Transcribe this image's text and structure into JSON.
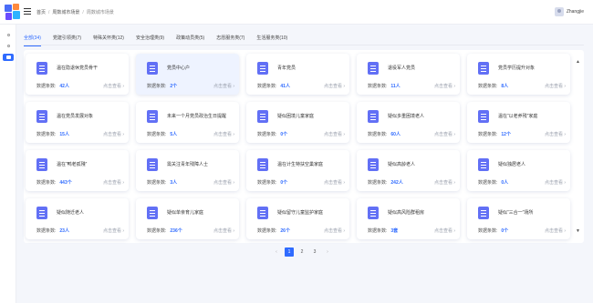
{
  "header": {
    "breadcrumb": [
      "首页",
      "周数城市场景",
      "周数城市场景"
    ],
    "user": "Zhangjie"
  },
  "tabs": [
    {
      "label": "全部(34)",
      "active": true
    },
    {
      "label": "党建引领类(7)"
    },
    {
      "label": "特殊关怀类(12)"
    },
    {
      "label": "安全治理类(9)"
    },
    {
      "label": "政策动员类(5)"
    },
    {
      "label": "志愿服务类(7)"
    },
    {
      "label": "生活服务类(10)"
    }
  ],
  "cards": [
    {
      "title": "温在隐退休党员骨干",
      "label": "数据条数:",
      "value": "42人",
      "link": "点击查看 ›"
    },
    {
      "title": "党员中心户",
      "label": "数据条数:",
      "value": "2个",
      "link": "点击查看 ›",
      "highlight": true
    },
    {
      "title": "青年党员",
      "label": "数据条数:",
      "value": "41人",
      "link": "点击查看 ›"
    },
    {
      "title": "退役军人党员",
      "label": "数据条数:",
      "value": "11人",
      "link": "点击查看 ›"
    },
    {
      "title": "党员学历提升对象",
      "label": "数据条数:",
      "value": "8人",
      "link": "点击查看 ›"
    },
    {
      "title": "温在党员发展对象",
      "label": "数据条数:",
      "value": "15人",
      "link": "点击查看 ›"
    },
    {
      "title": "未来一个月党员政治生日提醒",
      "label": "数据条数:",
      "value": "5人",
      "link": "点击查看 ›"
    },
    {
      "title": "疑似困境儿童家庭",
      "label": "数据条数:",
      "value": "0个",
      "link": "点击查看 ›"
    },
    {
      "title": "疑似多重困境老人",
      "label": "数据条数:",
      "value": "60人",
      "link": "点击查看 ›"
    },
    {
      "title": "温在“以老养残”家庭",
      "label": "数据条数:",
      "value": "12个",
      "link": "点击查看 ›"
    },
    {
      "title": "温在“鸭老孤殘”",
      "label": "数据条数:",
      "value": "443个",
      "link": "点击查看 ›"
    },
    {
      "title": "需关注青年残障人士",
      "label": "数据条数:",
      "value": "3人",
      "link": "点击查看 ›"
    },
    {
      "title": "温在计生特扶空巢家庭",
      "label": "数据条数:",
      "value": "0个",
      "link": "点击查看 ›"
    },
    {
      "title": "疑似高龄老人",
      "label": "数据条数:",
      "value": "242人",
      "link": "点击查看 ›"
    },
    {
      "title": "疑似独居老人",
      "label": "数据条数:",
      "value": "0人",
      "link": "点击查看 ›"
    },
    {
      "title": "疑似随迁老人",
      "label": "数据条数:",
      "value": "23人",
      "link": "点击查看 ›"
    },
    {
      "title": "疑似单亲育儿家庭",
      "label": "数据条数:",
      "value": "236个",
      "link": "点击查看 ›"
    },
    {
      "title": "疑似留守儿童监护家庭",
      "label": "数据条数:",
      "value": "26个",
      "link": "点击查看 ›"
    },
    {
      "title": "疑似高风险群租房",
      "label": "数据条数:",
      "value": "3套",
      "link": "点击查看 ›"
    },
    {
      "title": "疑似“三合一”场所",
      "label": "数据条数:",
      "value": "0个",
      "link": "点击查看 ›"
    }
  ],
  "pagination": {
    "prev": "‹",
    "pages": [
      "1",
      "2",
      "3"
    ],
    "current": "1",
    "next": "›"
  },
  "scroll": {
    "up": "▲",
    "down": "▼"
  },
  "colors": {
    "accent": "#2f6bff",
    "icon": "#6270f5"
  }
}
